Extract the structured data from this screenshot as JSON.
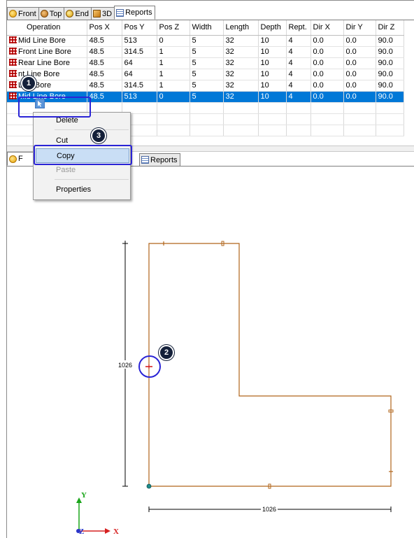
{
  "tabs_top": [
    {
      "label": "Front",
      "icon": "front-view-icon"
    },
    {
      "label": "Top",
      "icon": "top-view-icon"
    },
    {
      "label": "End",
      "icon": "end-view-icon"
    },
    {
      "label": "3D",
      "icon": "3d-view-icon"
    },
    {
      "label": "Reports",
      "icon": "reports-icon"
    }
  ],
  "tabs_bottom": [
    {
      "label": "F",
      "icon": "front-view-icon"
    },
    {
      "label": "Reports",
      "icon": "reports-icon"
    }
  ],
  "grid": {
    "headers": [
      "Operation",
      "Pos X",
      "Pos Y",
      "Pos Z",
      "Width",
      "Length",
      "Depth",
      "Rept.",
      "Dir X",
      "Dir Y",
      "Dir Z"
    ],
    "rows": [
      [
        "Mid Line Bore",
        "48.5",
        "513",
        "0",
        "5",
        "32",
        "10",
        "4",
        "0.0",
        "0.0",
        "90.0"
      ],
      [
        "Front Line Bore",
        "48.5",
        "314.5",
        "1",
        "5",
        "32",
        "10",
        "4",
        "0.0",
        "0.0",
        "90.0"
      ],
      [
        "Rear Line Bore",
        "48.5",
        "64",
        "1",
        "5",
        "32",
        "10",
        "4",
        "0.0",
        "0.0",
        "90.0"
      ],
      [
        "nt Line Bore",
        "48.5",
        "64",
        "1",
        "5",
        "32",
        "10",
        "4",
        "0.0",
        "0.0",
        "90.0"
      ],
      [
        "Line Bore",
        "48.5",
        "314.5",
        "1",
        "5",
        "32",
        "10",
        "4",
        "0.0",
        "0.0",
        "90.0"
      ],
      [
        "Mid Line Bore",
        "48.5",
        "513",
        "0",
        "5",
        "32",
        "10",
        "4",
        "0.0",
        "0.0",
        "90.0"
      ]
    ],
    "selected_row": 5,
    "row_icon": "line-bore-icon"
  },
  "context_menu": {
    "items": [
      {
        "label": "Delete",
        "enabled": true
      },
      {
        "label": "Cut",
        "enabled": true
      },
      {
        "label": "Copy",
        "enabled": true,
        "highlighted": true
      },
      {
        "label": "Paste",
        "enabled": false
      },
      {
        "label": "Properties",
        "enabled": true
      }
    ]
  },
  "badges": [
    "1",
    "2",
    "3"
  ],
  "drawing": {
    "vertical_dimension": "1026",
    "horizontal_dimension": "1026",
    "axis_y": "Y",
    "axis_x": "X",
    "axis_z": "Z",
    "part_color": "#b0651a",
    "marker_color": "#d62020",
    "callout_color": "#2a24d6"
  }
}
